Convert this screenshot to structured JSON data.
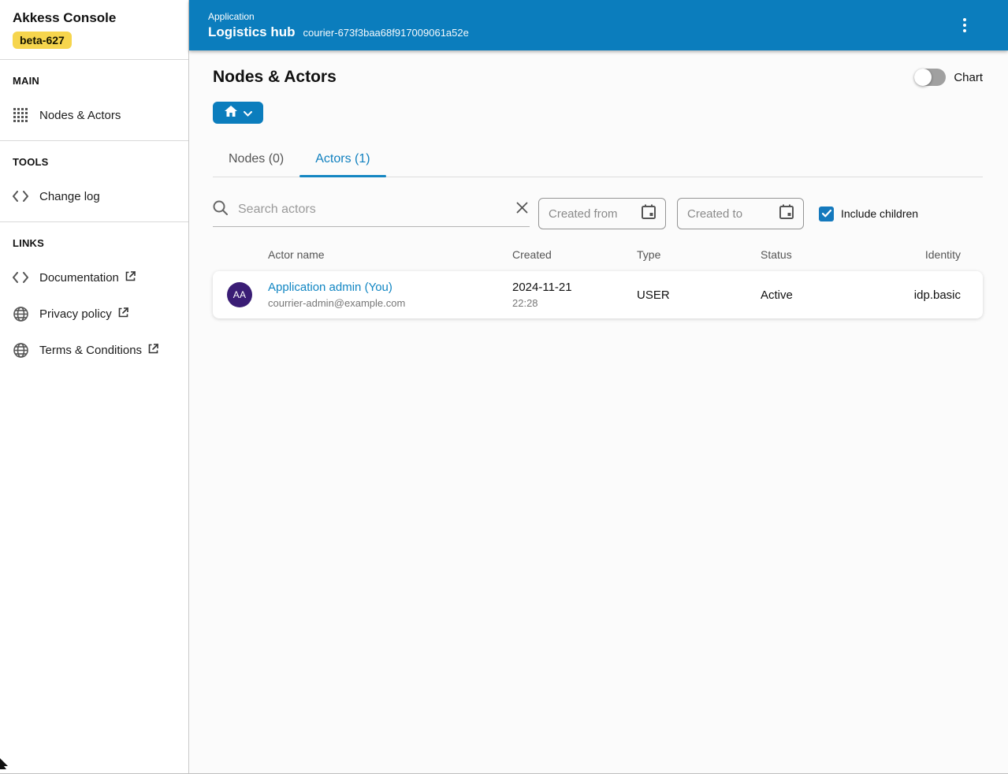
{
  "sidebar": {
    "app_title": "Akkess Console",
    "version_badge": "beta-627",
    "sections": [
      {
        "label": "MAIN",
        "items": [
          {
            "label": "Nodes & Actors",
            "icon": "grid"
          }
        ]
      },
      {
        "label": "TOOLS",
        "items": [
          {
            "label": "Change log",
            "icon": "code"
          }
        ]
      },
      {
        "label": "LINKS",
        "items": [
          {
            "label": "Documentation",
            "icon": "code",
            "external": true
          },
          {
            "label": "Privacy policy",
            "icon": "globe",
            "external": true
          },
          {
            "label": "Terms & Conditions",
            "icon": "globe",
            "external": true
          }
        ]
      }
    ]
  },
  "header": {
    "context_label": "Application",
    "app_name": "Logistics hub",
    "app_id": "courier-673f3baa68f917009061a52e",
    "menu_icon": "kebab-menu"
  },
  "main": {
    "page_title": "Nodes & Actors",
    "chart_toggle": {
      "label": "Chart",
      "on": false
    },
    "node_picker": {
      "icon": "home",
      "expand_icon": "chevron-down"
    },
    "tabs": [
      {
        "label": "Nodes (0)",
        "active": false
      },
      {
        "label": "Actors (1)",
        "active": true
      }
    ],
    "filters": {
      "search_placeholder": "Search actors",
      "created_from_placeholder": "Created from",
      "created_to_placeholder": "Created to",
      "include_children": {
        "label": "Include children",
        "checked": true
      }
    },
    "table": {
      "columns": [
        "Actor name",
        "Created",
        "Type",
        "Status",
        "Identity"
      ],
      "rows": [
        {
          "avatar_initials": "AA",
          "name": "Application admin (You)",
          "email": "courrier-admin@example.com",
          "created_date": "2024-11-21",
          "created_time": "22:28",
          "type": "USER",
          "status": "Active",
          "identity": "idp.basic"
        }
      ]
    }
  },
  "colors": {
    "header_blue": "#0b7dbd",
    "accent_blue": "#1486c2",
    "link_blue": "#1186c3",
    "badge_yellow": "#f6d54d",
    "avatar_purple": "#3a1d75",
    "checkbox_blue": "#1479bd",
    "toggle_off_gray": "#a0a0a0"
  }
}
